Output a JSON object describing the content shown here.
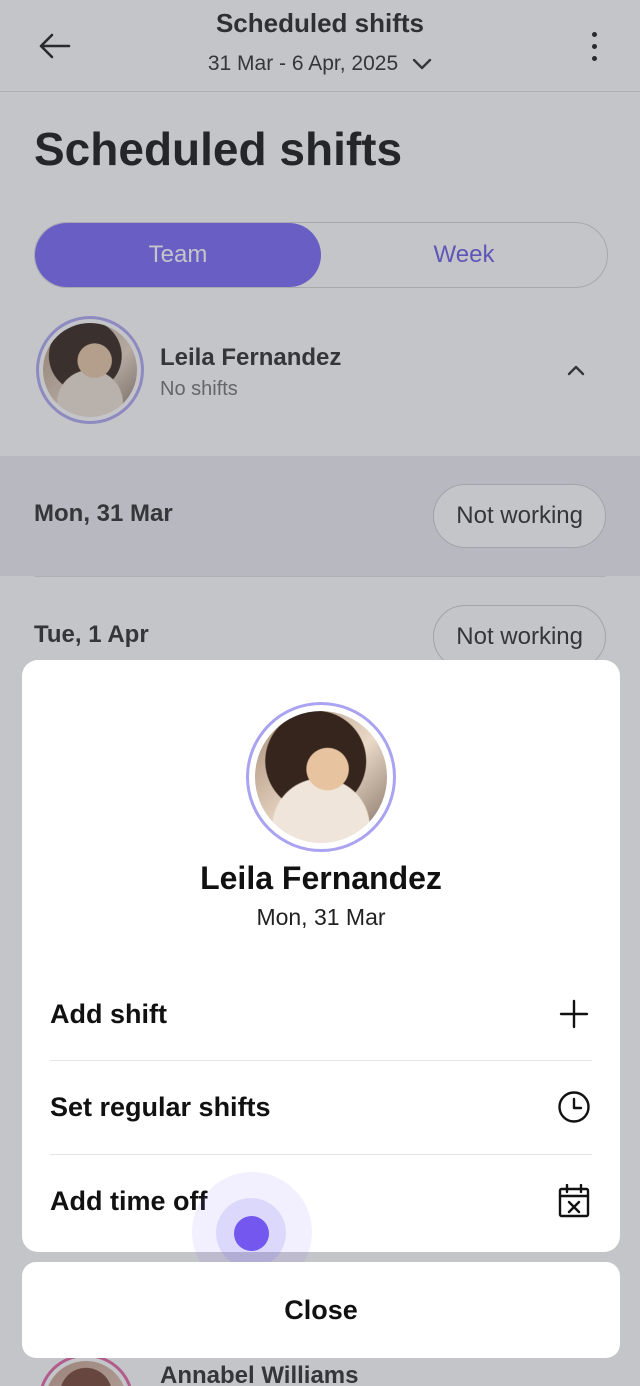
{
  "header": {
    "title": "Scheduled shifts",
    "date_range": "31 Mar - 6 Apr, 2025"
  },
  "page": {
    "title": "Scheduled shifts"
  },
  "tabs": [
    {
      "label": "Team",
      "active": true
    },
    {
      "label": "Week",
      "active": false
    }
  ],
  "member": {
    "name": "Leila Fernandez",
    "subtitle": "No shifts"
  },
  "days": [
    {
      "label": "Mon, 31 Mar",
      "status": "Not working"
    },
    {
      "label": "Tue, 1 Apr",
      "status": "Not working"
    }
  ],
  "next_member": {
    "name": "Annabel Williams"
  },
  "sheet": {
    "name": "Leila Fernandez",
    "date": "Mon, 31 Mar",
    "actions": [
      {
        "label": "Add shift",
        "icon": "plus-icon"
      },
      {
        "label": "Set regular shifts",
        "icon": "clock-icon"
      },
      {
        "label": "Add time off",
        "icon": "calendar-x-icon"
      }
    ],
    "close_label": "Close"
  },
  "colors": {
    "accent": "#7b6cf6",
    "accent_text": "#6f62e6",
    "touch_indicator": "#7357ee"
  }
}
